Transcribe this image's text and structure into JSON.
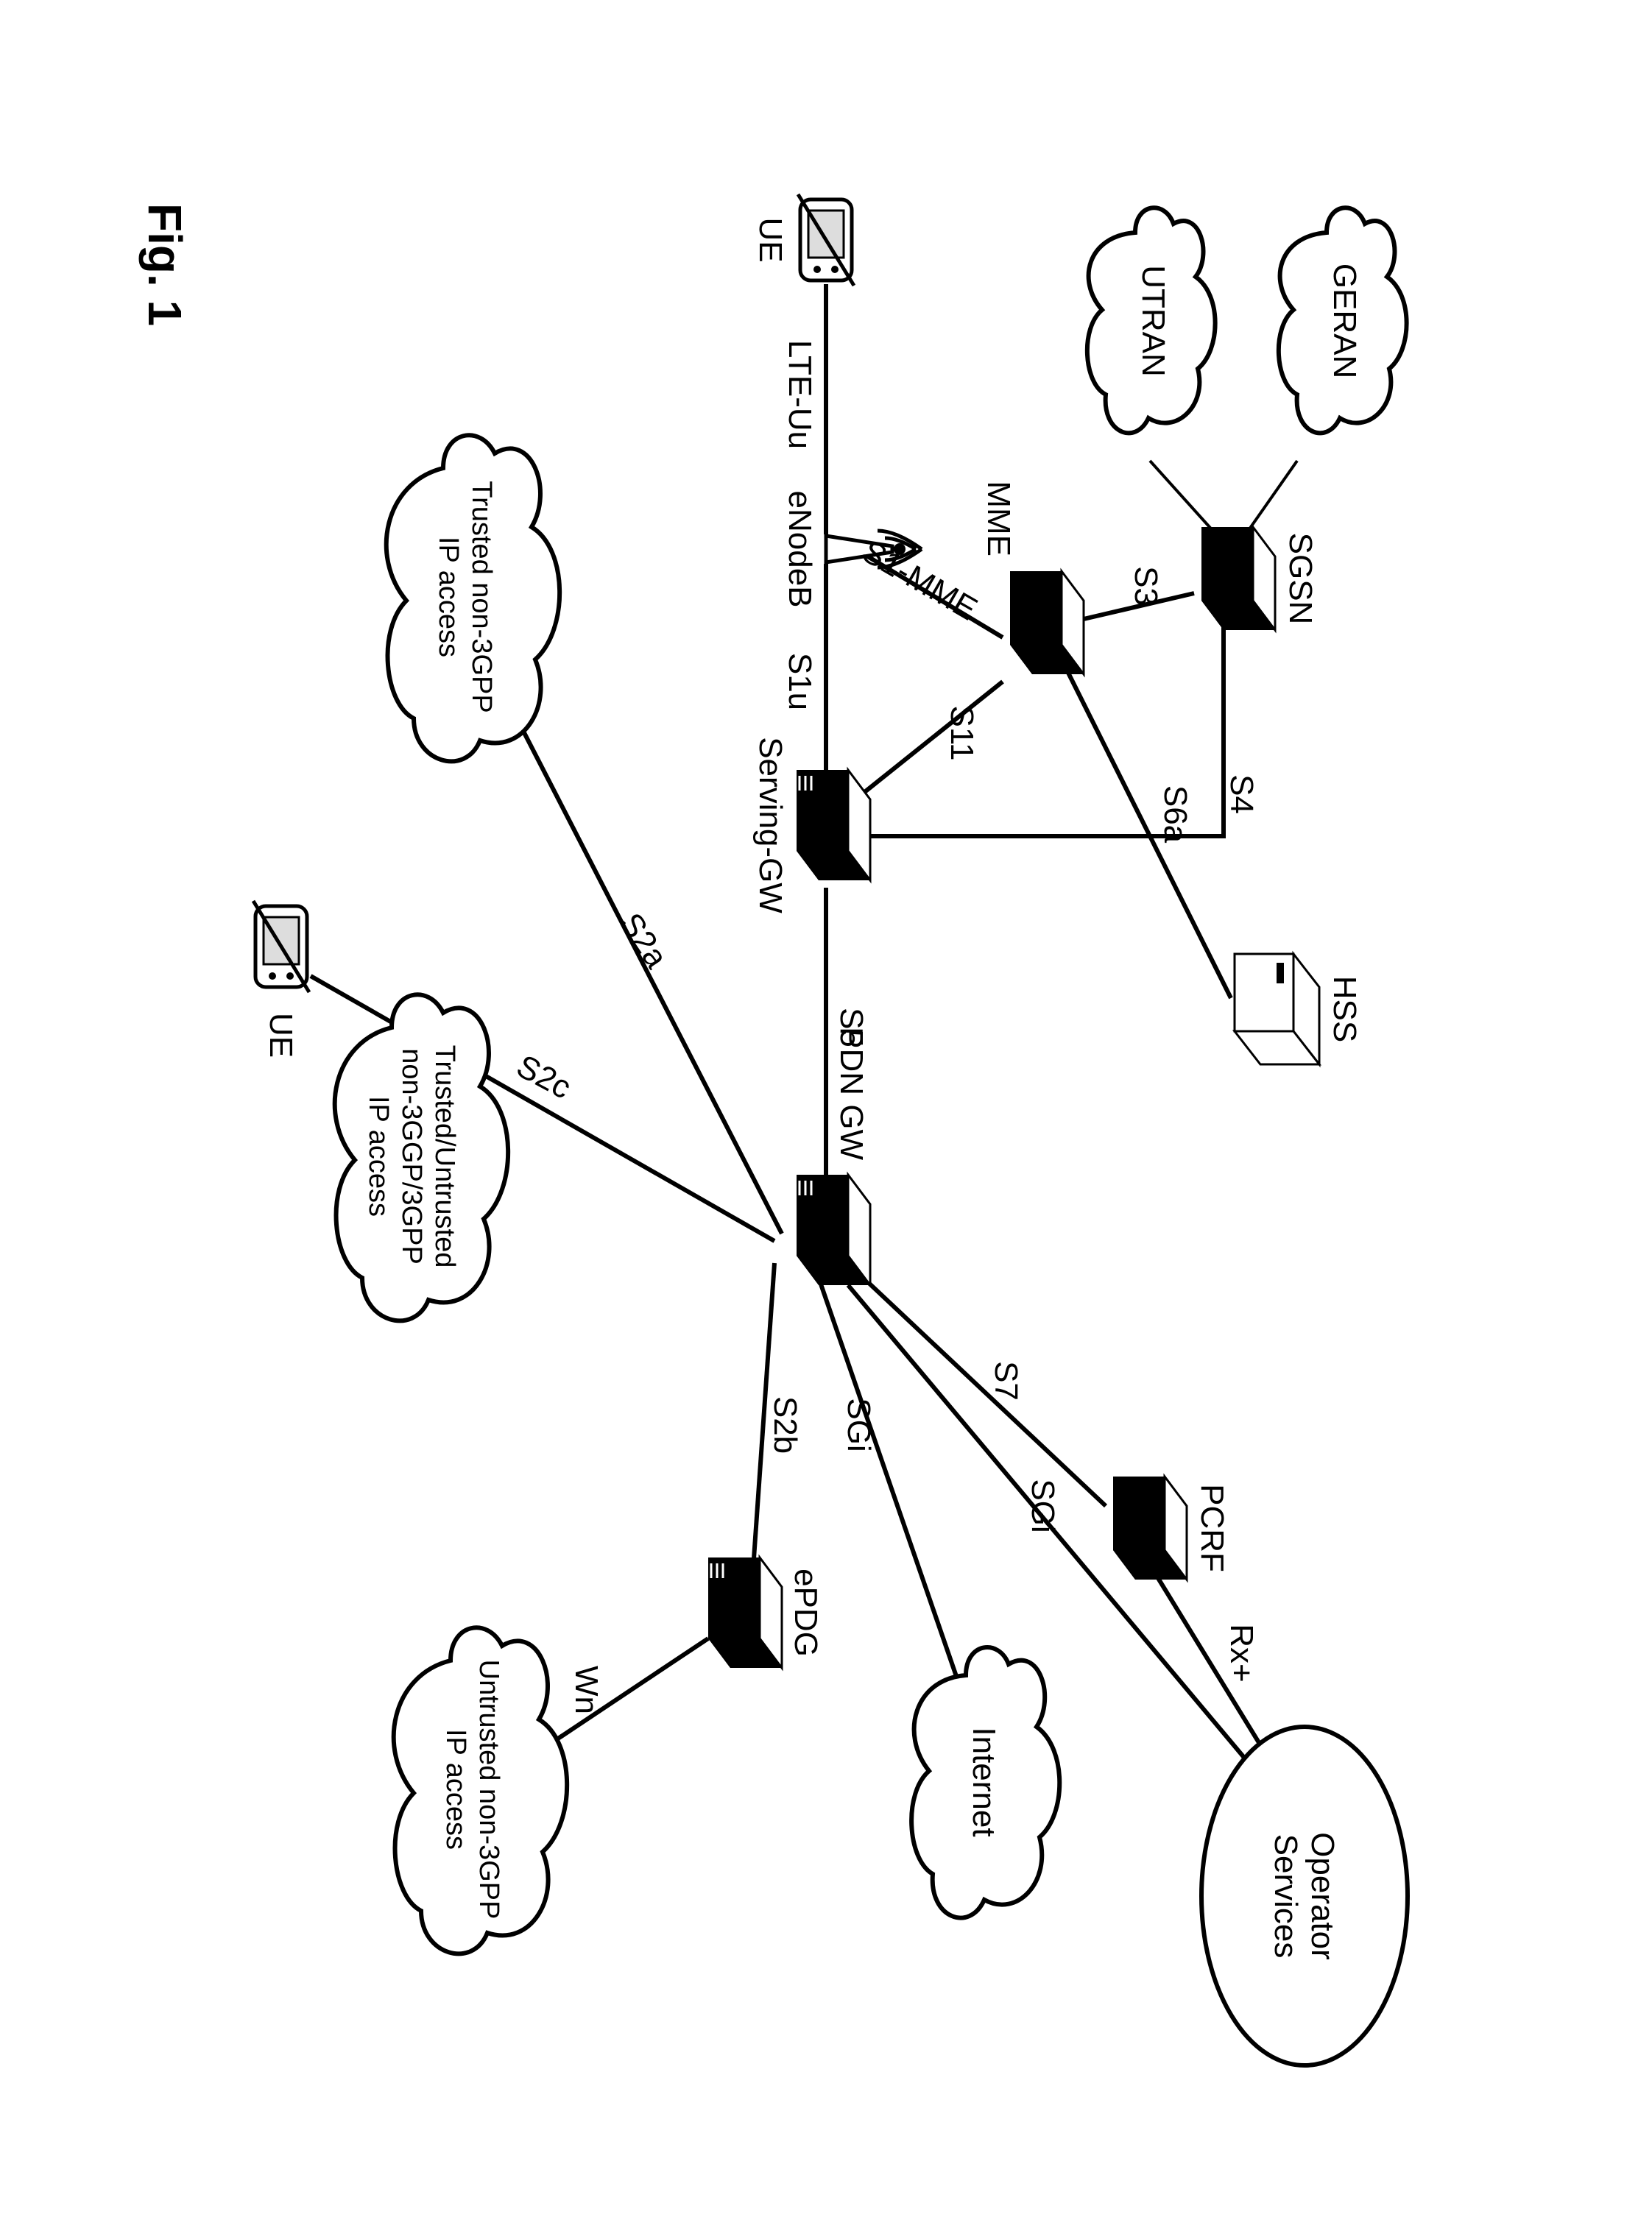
{
  "figure_label": "Fig. 1",
  "nodes": {
    "geran": "GERAN",
    "utran": "UTRAN",
    "sgsn": "SGSN",
    "hss": "HSS",
    "mme": "MME",
    "enodeb": "eNodeB",
    "sgw": "Serving-GW",
    "pdngw": "PDN GW",
    "pcrf": "PCRF",
    "epdg": "ePDG",
    "op_services": "Operator\nServices",
    "internet": "Internet",
    "trusted_non3gpp": "Trusted non-3GPP\nIP access",
    "mixed_non3gpp": "Trusted/Untrusted\nnon-3GGP/3GPP\nIP access",
    "untrusted_non3gpp": "Untrusted non-3GPP\nIP access",
    "ue1": "UE",
    "ue2": "UE"
  },
  "interfaces": {
    "lte_uu": "LTE-Uu",
    "s1u": "S1u",
    "s1_mme": "S1-MME",
    "s3": "S3",
    "s4": "S4",
    "s5": "S5",
    "s6a": "S6a",
    "s7": "S7",
    "s11": "S11",
    "sgi1": "SGi",
    "sgi2": "SGi",
    "rxplus": "Rx+",
    "s2a": "S2a",
    "s2b": "S2b",
    "s2c": "S2c",
    "wn": "Wn"
  }
}
